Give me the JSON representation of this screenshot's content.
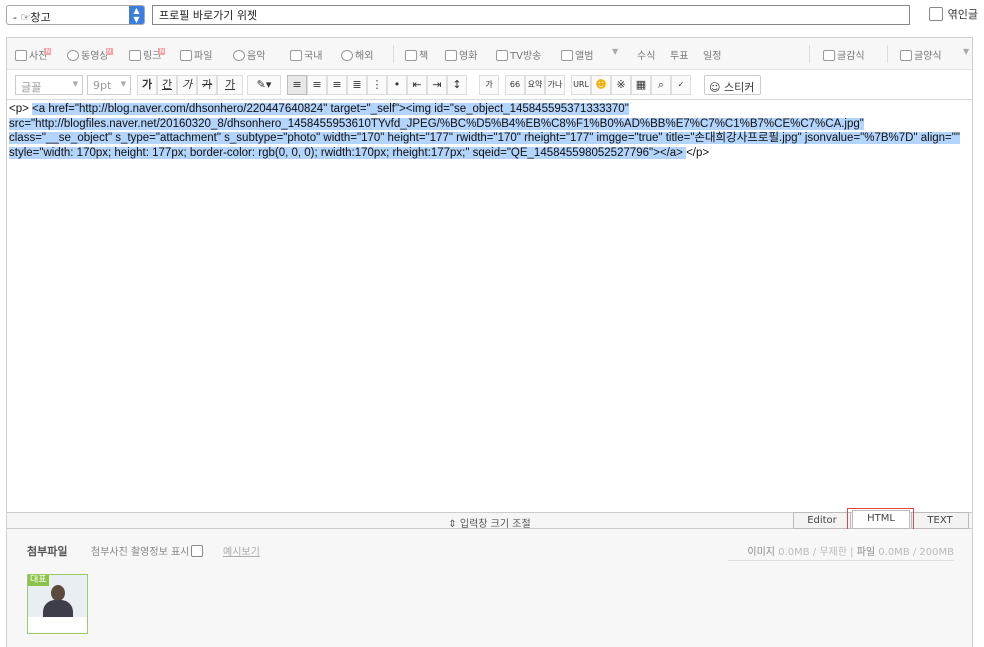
{
  "top": {
    "category_value": "- ☞창고",
    "title_value": "프로필 바로가기 위젯",
    "trackback_label": "엮인글"
  },
  "toolbar1": {
    "photo": "사진",
    "video": "동영상",
    "link": "링크",
    "file": "파일",
    "music": "음악",
    "domestic": "국내",
    "overseas": "해외",
    "book": "책",
    "movie": "영화",
    "tv": "TV방송",
    "album": "앨범",
    "formula": "수식",
    "vote": "투표",
    "schedule": "일정",
    "template": "글감식",
    "style": "글양식"
  },
  "toolbar2": {
    "font": "글꼴",
    "size": "9pt",
    "bold": "가",
    "underline": "간",
    "italic": "가",
    "strike": "가",
    "color": "가",
    "quote": "66",
    "summary": "요약",
    "spell": "가나",
    "url": "URL",
    "sticker": "스티커"
  },
  "code": {
    "open_p": "<p> ",
    "selected": "<a href=\"http://blog.naver.com/dhsonhero/220447640824\" target=\"_self\"><img id=\"se_object_145845595371333370\" src=\"http://blogfiles.naver.net/20160320_8/dhsonhero_1458455953610TYvfd_JPEG/%BC%D5%B4%EB%C8%F1%B0%AD%BB%E7%C7%C1%B7%CE%C7%CA.jpg\" class=\"__se_object\" s_type=\"attachment\" s_subtype=\"photo\" width=\"170\" height=\"177\" rwidth=\"170\" rheight=\"177\" imgge=\"true\" title=\"손대희강사프로필.jpg\" jsonvalue=\"%7B%7D\" align=\"\" style=\"width: 170px; height: 177px; border-color: rgb(0, 0, 0); rwidth:170px; rheight:177px;\" sqeid=\"QE_145845598052527796\"></a> ",
    "close_p": "</p>"
  },
  "resize": {
    "label": "⇕ 입력창 크기 조절",
    "tab_editor": "Editor",
    "tab_html": "HTML",
    "tab_text": "TEXT"
  },
  "attach": {
    "title": "첨부파일",
    "exif_label": "첨부사진 촬영정보 표시",
    "sample_link": "예시보기",
    "image_label": "이미지",
    "image_value": "0.0MB",
    "image_limit": "무제한",
    "file_label": "파일",
    "file_value": "0.0MB",
    "file_limit": "200MB",
    "thumb_badge": "대표"
  },
  "colors": {
    "selection": "#b3d4fc",
    "highlight_box": "#e04545",
    "select_arrow": "#3b7ee0",
    "thumb_border": "#9ccc65"
  }
}
